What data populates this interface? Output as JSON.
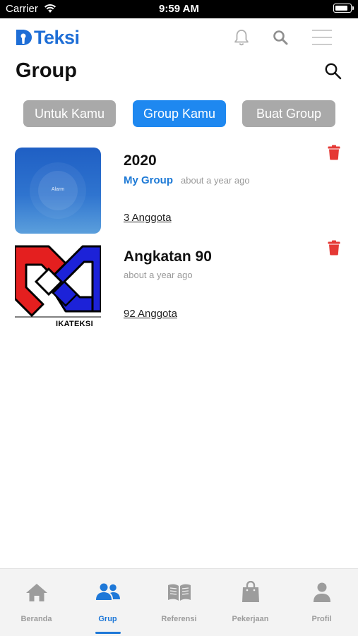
{
  "status_bar": {
    "carrier": "Carrier",
    "time": "9:59 AM",
    "battery_level": 0.92
  },
  "app": {
    "logo_text": "Teksi",
    "brand_color": "#1e6ed6"
  },
  "header": {
    "icons": [
      "bell-icon",
      "search-icon",
      "menu-icon"
    ]
  },
  "page": {
    "title": "Group"
  },
  "filters": [
    {
      "label": "Untuk Kamu",
      "active": false
    },
    {
      "label": "Group Kamu",
      "active": true
    },
    {
      "label": "Buat Group",
      "active": false
    }
  ],
  "groups": [
    {
      "name": "2020",
      "tag": "My Group",
      "time": "about a year ago",
      "members": "3 Anggota",
      "thumb_text": "Alarm"
    },
    {
      "name": "Angkatan 90",
      "tag": "",
      "time": "about a year ago",
      "members": "92 Anggota",
      "thumb_text": "IKATEKSI"
    }
  ],
  "bottom_nav": [
    {
      "label": "Beranda",
      "icon": "home-icon",
      "active": false
    },
    {
      "label": "Grup",
      "icon": "users-icon",
      "active": true
    },
    {
      "label": "Referensi",
      "icon": "book-icon",
      "active": false
    },
    {
      "label": "Pekerjaan",
      "icon": "briefcase-icon",
      "active": false
    },
    {
      "label": "Profil",
      "icon": "user-icon",
      "active": false
    }
  ],
  "colors": {
    "accent": "#1e88f0",
    "pill_inactive": "#a9a9a9",
    "danger": "#e53935",
    "nav_active": "#1e78d8"
  }
}
